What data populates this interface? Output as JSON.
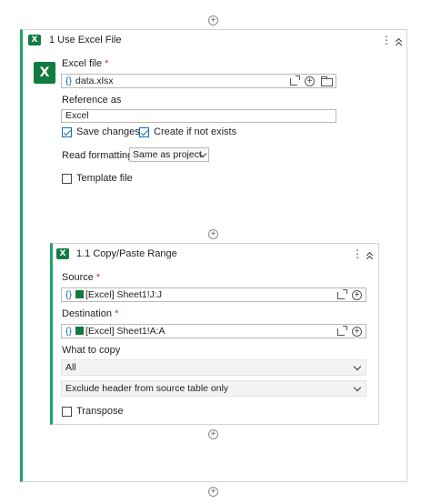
{
  "outer": {
    "title": "1  Use Excel File",
    "excel_icon": "excel-icon",
    "excel_file": {
      "label": "Excel file",
      "required_mark": "*",
      "value": "data.xlsx",
      "brace": "{}"
    },
    "reference": {
      "label": "Reference as",
      "value": "Excel"
    },
    "save_changes": {
      "label": "Save changes",
      "checked": true
    },
    "create_if_not_exists": {
      "label": "Create if not exists",
      "checked": true
    },
    "read_formatting": {
      "label": "Read formatting",
      "value": "Same as project"
    },
    "template_file": {
      "label": "Template file",
      "checked": false
    }
  },
  "inner": {
    "title": "1.1  Copy/Paste Range",
    "excel_icon": "excel-icon",
    "source": {
      "label": "Source",
      "required_mark": "*",
      "brace": "{}",
      "value": "[Excel] Sheet1!J:J"
    },
    "destination": {
      "label": "Destination",
      "required_mark": "*",
      "brace": "{}",
      "value": "[Excel] Sheet1!A:A"
    },
    "what_to_copy": {
      "label": "What to copy",
      "value": "All"
    },
    "header_option": {
      "value": "Exclude header from source table only"
    },
    "transpose": {
      "label": "Transpose",
      "checked": false
    }
  },
  "icons": {
    "add": "+",
    "more": "⋮",
    "xl_letter": "X"
  },
  "colors": {
    "accent_green": "#21a366",
    "excel_green": "#107c41",
    "link_blue": "#0f6cbd"
  }
}
